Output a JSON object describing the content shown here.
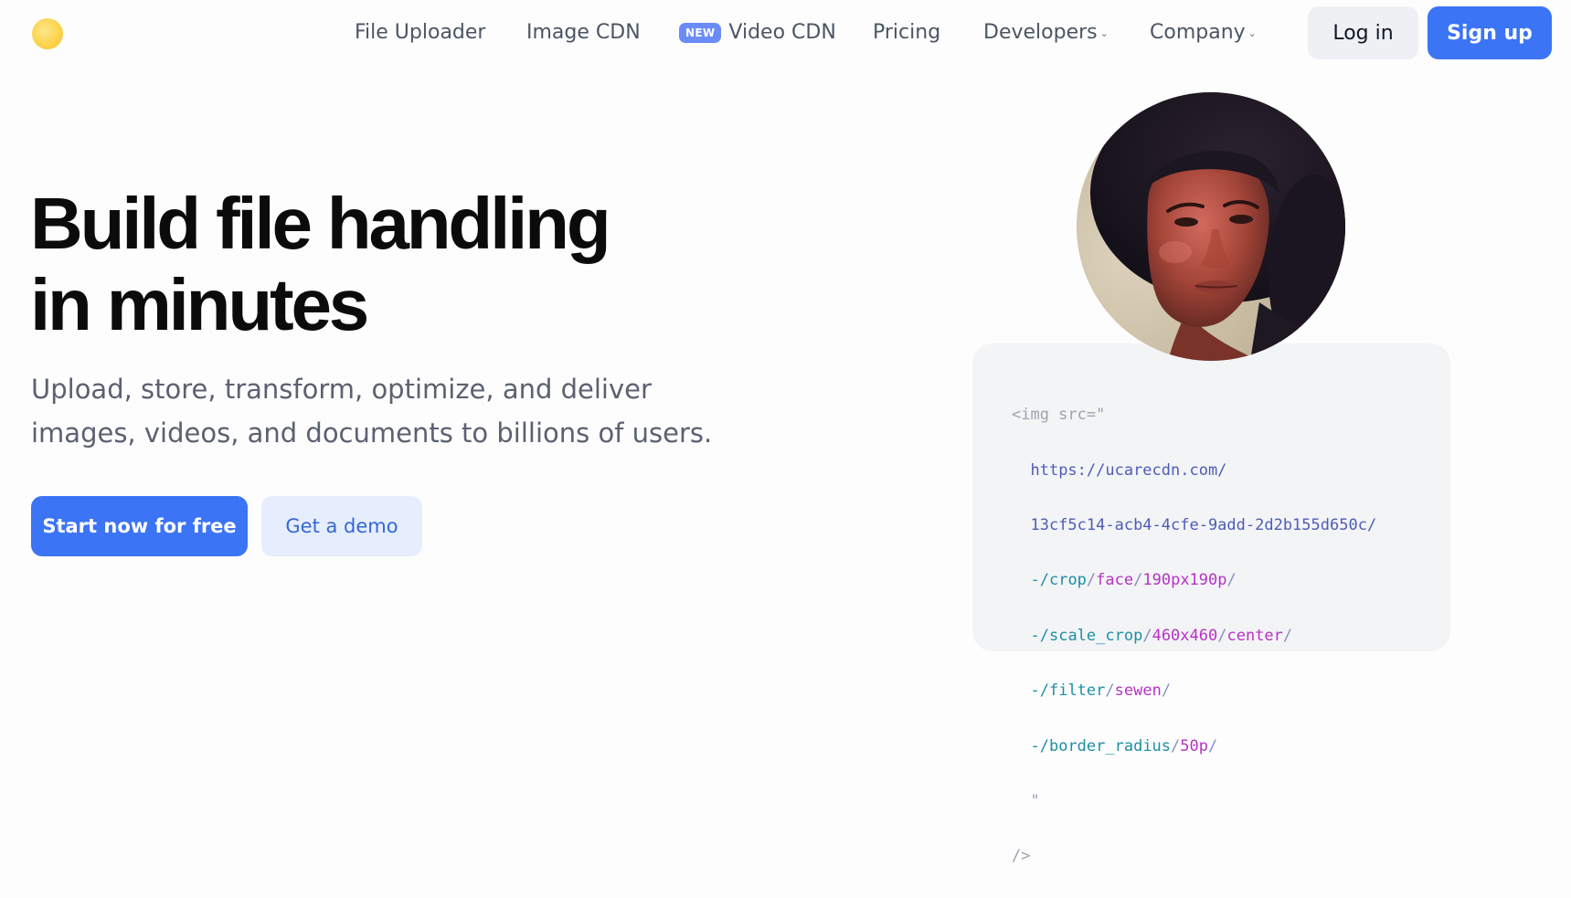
{
  "header": {
    "nav": [
      {
        "label": "File Uploader"
      },
      {
        "label": "Image CDN"
      },
      {
        "label": "Video CDN",
        "badge": "NEW"
      },
      {
        "label": "Pricing"
      },
      {
        "label": "Developers",
        "dropdown": true
      },
      {
        "label": "Company",
        "dropdown": true
      }
    ],
    "login_label": "Log in",
    "signup_label": "Sign up"
  },
  "hero": {
    "title_lines": [
      "Build file handling",
      "in minutes"
    ],
    "subtitle_lines": [
      "Upload, store, transform, optimize, and deliver",
      "images, videos, and documents to billions of users."
    ],
    "primary_cta": "Start now for free",
    "secondary_cta": "Get a demo"
  },
  "code_sample": {
    "open_tag": "<img src=\"",
    "host": "https://ucarecdn.com/",
    "uuid": "13cf5c14-acb4-4cfe-9add-2d2b155d650c/",
    "ops": [
      {
        "prefix": "-/",
        "op": "crop",
        "params": [
          {
            "sep": "/",
            "v": "face"
          },
          {
            "sep": "/",
            "v": "190px190p"
          }
        ],
        "end": "/"
      },
      {
        "prefix": "-/",
        "op": "scale_crop",
        "params": [
          {
            "sep": "/",
            "v": "460x460"
          },
          {
            "sep": "/",
            "v": "center"
          }
        ],
        "end": "/"
      },
      {
        "prefix": "-/",
        "op": "filter",
        "params": [
          {
            "sep": "/",
            "v": "sewen"
          }
        ],
        "end": "/"
      },
      {
        "prefix": "-/",
        "op": "border_radius",
        "params": [
          {
            "sep": "/",
            "v": "50p"
          }
        ],
        "end": "/"
      }
    ],
    "close_quote": "\"",
    "close_tag": "/>"
  },
  "colors": {
    "accent": "#3b74f5",
    "badge": "#6b8cf7",
    "code_url": "#4d5db8",
    "code_op": "#1b8fa3",
    "code_value": "#b632c4"
  }
}
